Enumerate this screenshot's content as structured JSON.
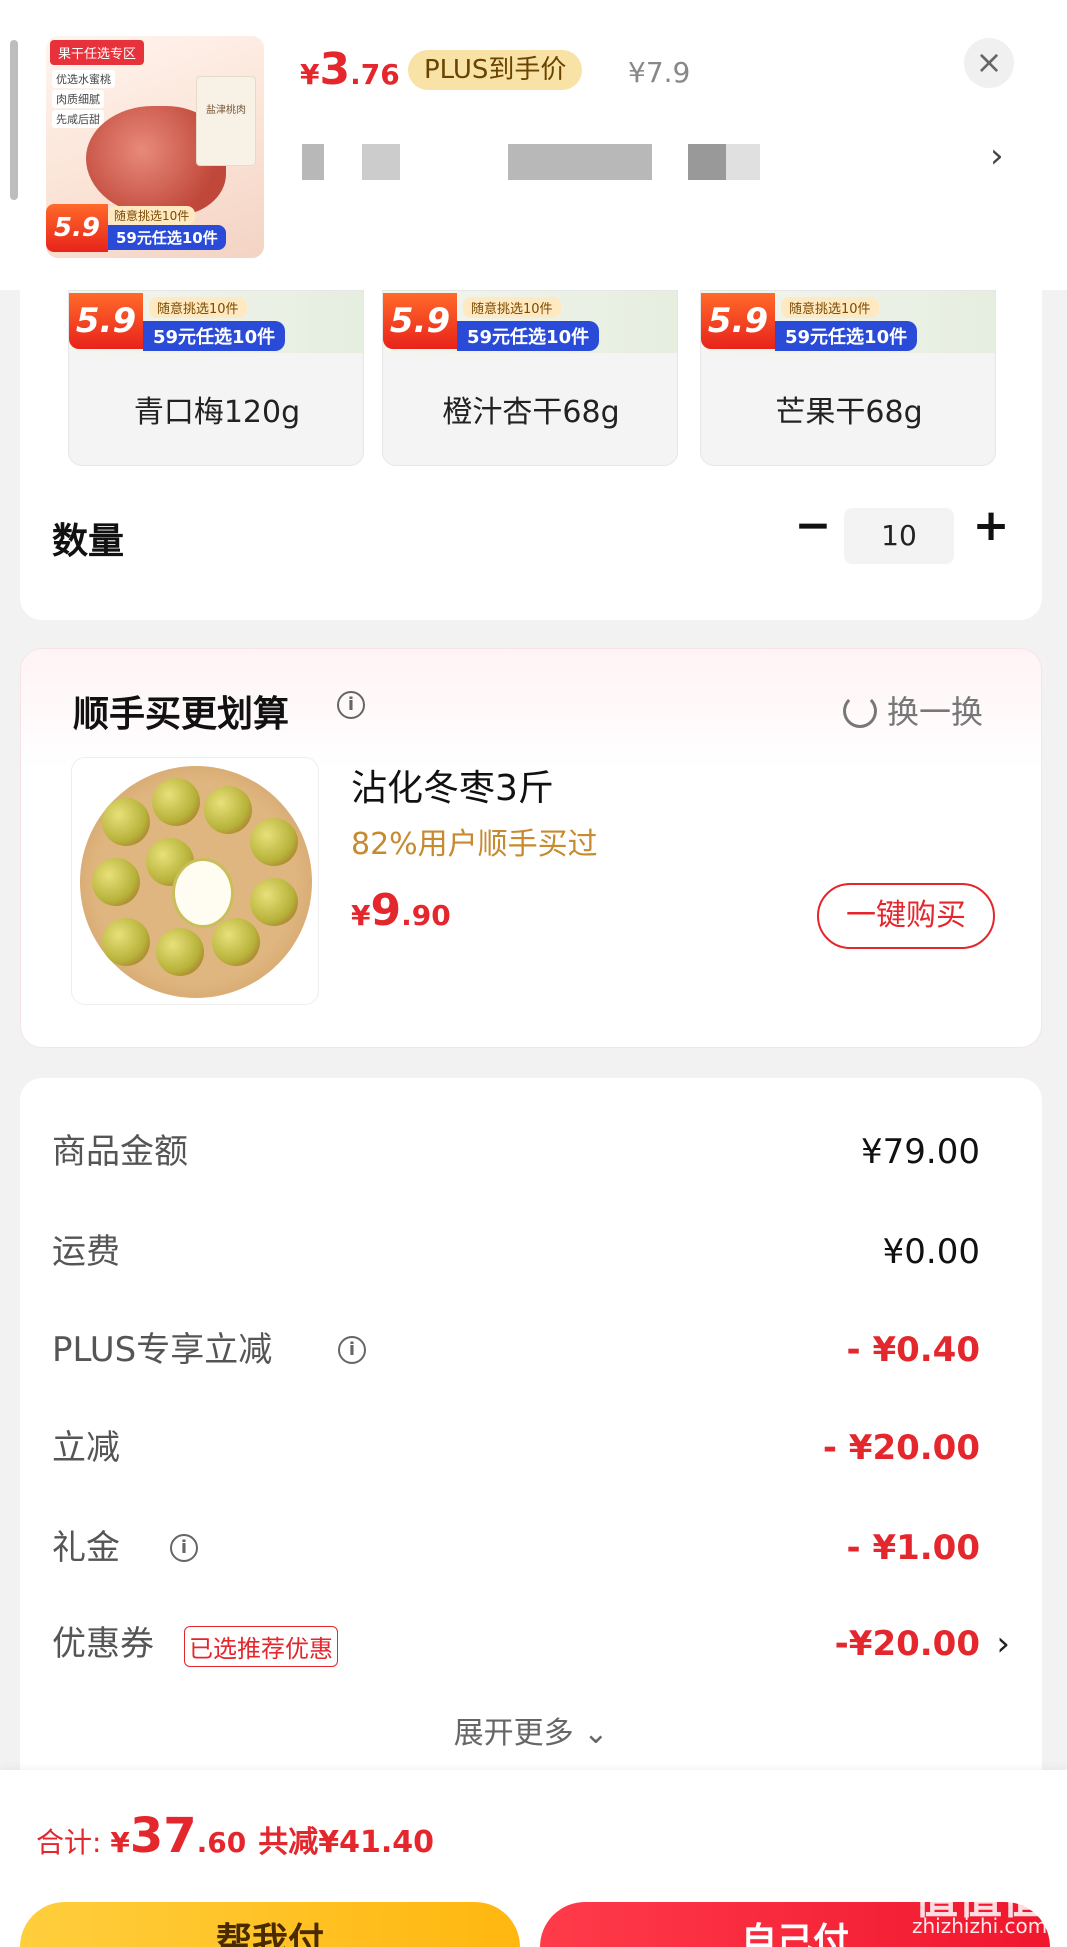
{
  "header": {
    "thumb": {
      "tag": "果干任选专区",
      "bullets": [
        "优选水蜜桃",
        "肉质细腻",
        "先咸后甜"
      ],
      "bag_text": "盐津桃肉",
      "badge_price": "5.9",
      "badge_top": "随意挑选10件",
      "badge_bottom": "59元任选10件"
    },
    "price_symbol": "¥",
    "price_int": "3",
    "price_dec": ".76",
    "plus_tag": "PLUS到手价",
    "orig_price": "¥7.9",
    "close_icon": "×",
    "selector_chevron": "›"
  },
  "variants": [
    {
      "name": "青口梅120g",
      "badge_price": "5.9",
      "badge_top": "随意挑选10件",
      "badge_bottom": "59元任选10件"
    },
    {
      "name": "橙汁杏干68g",
      "badge_price": "5.9",
      "badge_top": "随意挑选10件",
      "badge_bottom": "59元任选10件"
    },
    {
      "name": "芒果干68g",
      "badge_price": "5.9",
      "badge_top": "随意挑选10件",
      "badge_bottom": "59元任选10件"
    }
  ],
  "quantity": {
    "label": "数量",
    "minus": "−",
    "value": "10",
    "plus": "+"
  },
  "recommend": {
    "title": "顺手买更划算",
    "info_icon": "i",
    "refresh_label": "换一换",
    "product_name": "沾化冬枣3斤",
    "subtitle": "82%用户顺手买过",
    "price_symbol": "¥",
    "price_int": "9",
    "price_dec": ".90",
    "buy_label": "一键购买"
  },
  "fees": {
    "goods_label": "商品金额",
    "goods_value": "¥79.00",
    "shipping_label": "运费",
    "shipping_value": "¥0.00",
    "plus_label": "PLUS专享立减",
    "plus_value": "- ¥0.40",
    "discount_label": "立减",
    "discount_value": "- ¥20.00",
    "gift_label": "礼金",
    "gift_value": "- ¥1.00",
    "coupon_label": "优惠券",
    "coupon_tag": "已选推荐优惠",
    "coupon_value": "-¥20.00",
    "coupon_chevron": "›",
    "expand_label": "展开更多 ⌄",
    "info_icon": "i"
  },
  "bottom": {
    "total_label": "合计: ",
    "total_symbol": "¥",
    "total_int": "37",
    "total_dec": ".60",
    "saved": "共减¥41.40",
    "help_pay": "帮我付",
    "self_pay": "自己付"
  },
  "watermark": {
    "main": "值值值",
    "url": "zhizhizhi.com"
  },
  "colors": {
    "accent_red": "#e4262d",
    "plus_gold": "#f9e2a5",
    "help_btn": "#ffc21f",
    "subtitle_orange": "#c78a2f"
  }
}
